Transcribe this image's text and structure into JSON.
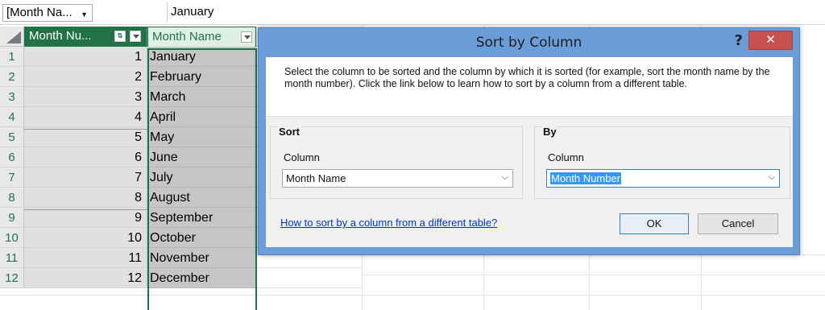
{
  "formula_bar": {
    "name_box": "[Month Na...",
    "value": "January"
  },
  "grid": {
    "columns": [
      {
        "header": "Month Nu..."
      },
      {
        "header": "Month Name"
      }
    ],
    "rows": [
      {
        "row": "1",
        "number": "1",
        "name": "January"
      },
      {
        "row": "2",
        "number": "2",
        "name": "February"
      },
      {
        "row": "3",
        "number": "3",
        "name": "March"
      },
      {
        "row": "4",
        "number": "4",
        "name": "April"
      },
      {
        "row": "5",
        "number": "5",
        "name": "May"
      },
      {
        "row": "6",
        "number": "6",
        "name": "June"
      },
      {
        "row": "7",
        "number": "7",
        "name": "July"
      },
      {
        "row": "8",
        "number": "8",
        "name": "August"
      },
      {
        "row": "9",
        "number": "9",
        "name": "September"
      },
      {
        "row": "10",
        "number": "10",
        "name": "October"
      },
      {
        "row": "11",
        "number": "11",
        "name": "November"
      },
      {
        "row": "12",
        "number": "12",
        "name": "December"
      }
    ]
  },
  "dialog": {
    "title": "Sort by Column",
    "help": "?",
    "close": "✕",
    "description": "Select the column to be sorted and the column by which it is sorted (for example, sort the month name by the month number). Click the link below to learn how to sort by a column from a different table.",
    "sort": {
      "title": "Sort",
      "column_label": "Column",
      "value": "Month Name"
    },
    "by": {
      "title": "By",
      "column_label": "Column",
      "value": "Month Number"
    },
    "link": "How to sort by a column from a different table?",
    "ok": "OK",
    "cancel": "Cancel"
  },
  "colors": {
    "header_green": "#217346",
    "dialog_frame": "#6b9ed9",
    "close_red": "#c75050",
    "selection_blue": "#3399ff"
  }
}
